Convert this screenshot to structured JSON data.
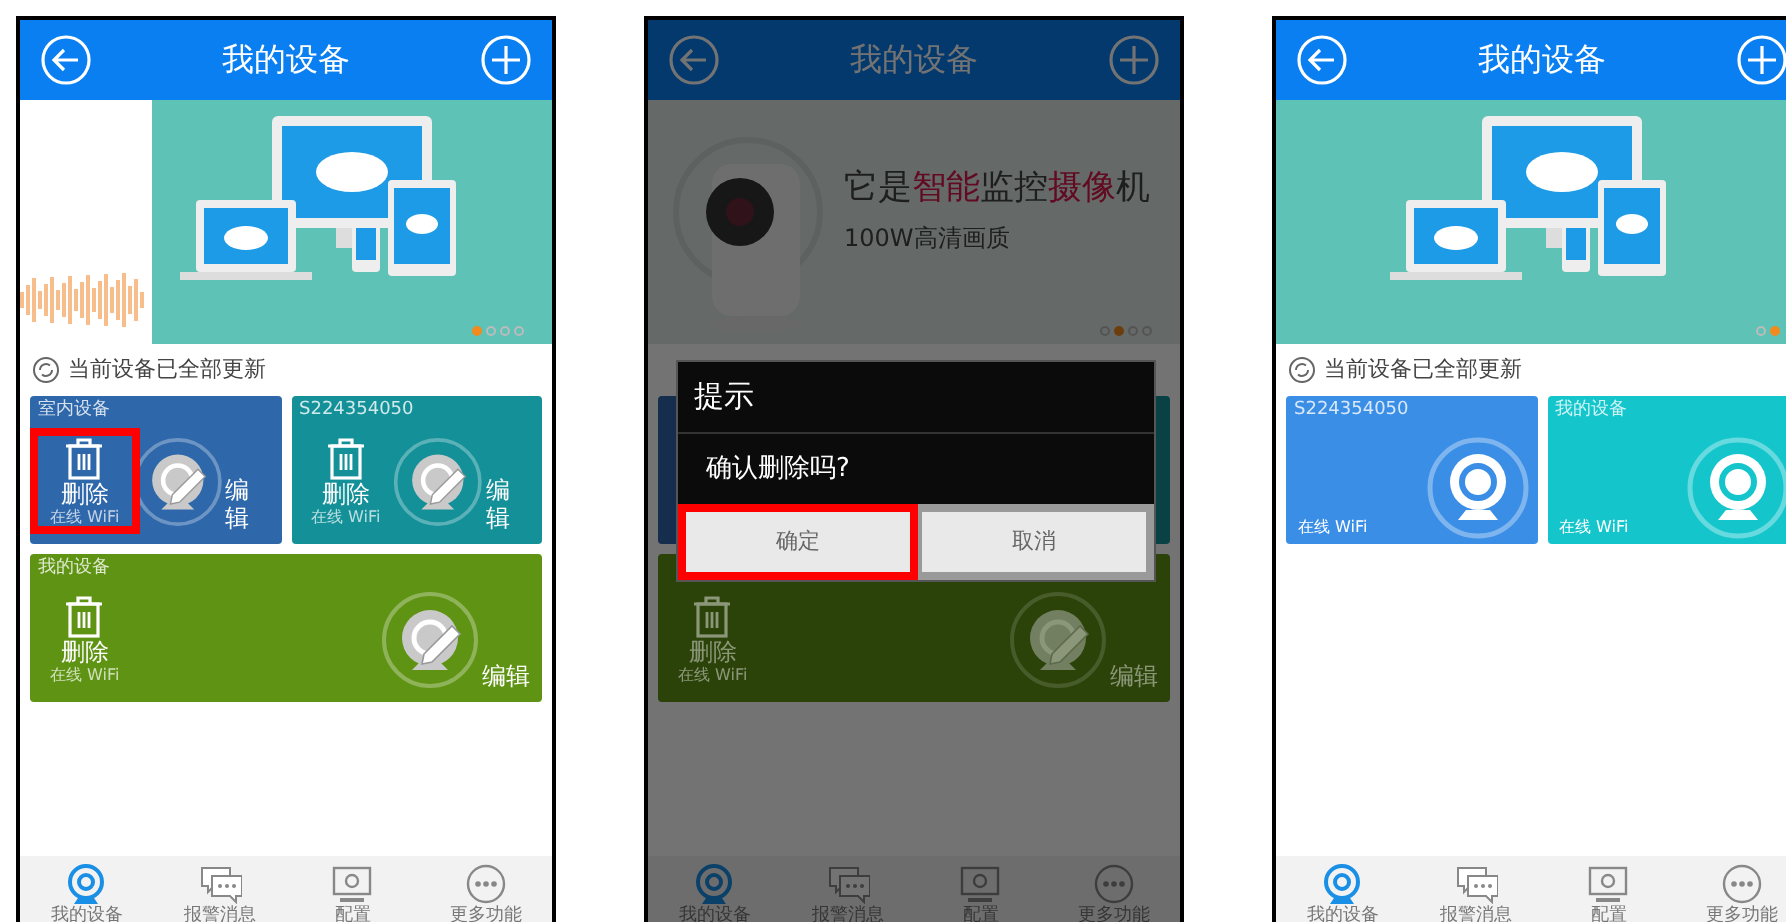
{
  "phones": [
    {
      "header": {
        "title": "我的设备"
      },
      "banner": {
        "kind": "transition",
        "dots": [
          {
            "selected": true
          },
          {
            "selected": false
          },
          {
            "selected": false
          },
          {
            "selected": false
          }
        ]
      },
      "status": "当前设备已全部更新",
      "cards": [
        {
          "kind": "edit",
          "color": "#2e67aa",
          "wide": false,
          "name": "室内设备",
          "delete_label": "删除",
          "edit_label": "编辑",
          "status": "在线 WiFi",
          "highlighted": true
        },
        {
          "kind": "edit",
          "color": "#139098",
          "wide": false,
          "name": "S224354050",
          "delete_label": "删除",
          "edit_label": "编辑",
          "status": "在线 WiFi",
          "highlighted": false
        },
        {
          "kind": "edit",
          "color": "#5f9313",
          "wide": true,
          "name": "我的设备",
          "delete_label": "删除",
          "edit_label": "编辑",
          "status": "在线 WiFi",
          "highlighted": false
        }
      ],
      "nav": [
        {
          "label": "我的设备",
          "selected": true
        },
        {
          "label": "报警消息",
          "selected": false
        },
        {
          "label": "配置",
          "selected": false
        },
        {
          "label": "更多功能",
          "selected": false
        }
      ]
    },
    {
      "header": {
        "title": "我的设备"
      },
      "banner": {
        "kind": "camera",
        "headline": [
          {
            "text": "它是",
            "accent": false
          },
          {
            "text": "智能",
            "accent": true
          },
          {
            "text": "监控",
            "accent": false
          },
          {
            "text": "摄像",
            "accent": true
          },
          {
            "text": "机",
            "accent": false
          }
        ],
        "subtitle": "100W高清画质",
        "dots": [
          {
            "selected": false
          },
          {
            "selected": true
          },
          {
            "selected": false
          },
          {
            "selected": false
          }
        ]
      },
      "cards": [
        {
          "kind": "covered",
          "color": "#152e4d",
          "wide": false
        },
        {
          "kind": "covered",
          "color": "#094145",
          "wide": false
        },
        {
          "kind": "edit",
          "color": "#2b4209",
          "wide": true,
          "delete_label": "删除",
          "edit_label": "编辑",
          "status": "在线 WiFi",
          "highlighted": false
        }
      ],
      "nav": [
        {
          "label": "我的设备",
          "selected": true
        },
        {
          "label": "报警消息",
          "selected": false
        },
        {
          "label": "配置",
          "selected": false
        },
        {
          "label": "更多功能",
          "selected": false
        }
      ],
      "dialog": {
        "title": "提示",
        "message": "确认删除吗?",
        "buttons": [
          {
            "label": "确定",
            "highlighted": true
          },
          {
            "label": "取消",
            "highlighted": false
          }
        ]
      }
    },
    {
      "header": {
        "title": "我的设备"
      },
      "banner": {
        "kind": "devices",
        "dots": [
          {
            "selected": false
          },
          {
            "selected": true
          }
        ]
      },
      "status": "当前设备已全部更新",
      "cards": [
        {
          "kind": "normal",
          "color": "#3a8ee6",
          "wide": false,
          "name": "S224354050",
          "status": "在线 WiFi"
        },
        {
          "kind": "normal",
          "color": "#14c6cc",
          "wide": false,
          "name": "我的设备",
          "status": "在线 WiFi"
        }
      ],
      "nav": [
        {
          "label": "我的设备",
          "selected": true
        },
        {
          "label": "报警消息",
          "selected": false
        },
        {
          "label": "配置",
          "selected": false
        },
        {
          "label": "更多功能",
          "selected": false
        }
      ]
    }
  ]
}
